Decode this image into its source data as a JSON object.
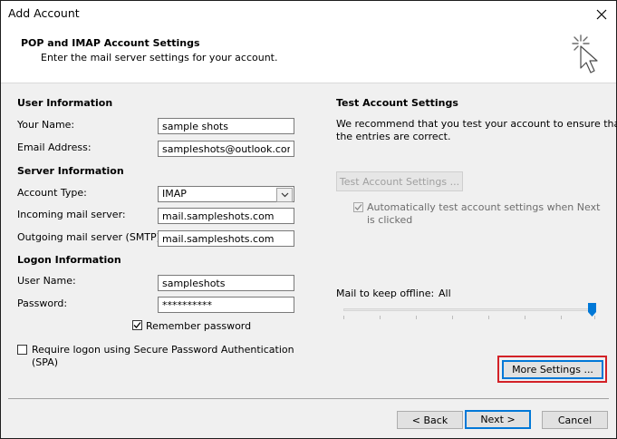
{
  "window": {
    "title": "Add Account"
  },
  "header": {
    "title": "POP and IMAP Account Settings",
    "subtitle": "Enter the mail server settings for your account."
  },
  "user_information": {
    "heading": "User Information",
    "your_name_label": "Your Name:",
    "your_name_value": "sample shots",
    "email_label": "Email Address:",
    "email_value": "sampleshots@outlook.com"
  },
  "server_information": {
    "heading": "Server Information",
    "account_type_label": "Account Type:",
    "account_type_value": "IMAP",
    "incoming_label": "Incoming mail server:",
    "incoming_value": "mail.sampleshots.com",
    "outgoing_label": "Outgoing mail server (SMTP):",
    "outgoing_value": "mail.sampleshots.com"
  },
  "logon_information": {
    "heading": "Logon Information",
    "user_name_label": "User Name:",
    "user_name_value": "sampleshots",
    "password_label": "Password:",
    "password_value": "**********",
    "remember_label": "Remember password",
    "remember_checked": true,
    "spa_label_line1": "Require logon using Secure Password Authentication",
    "spa_label_line2": "(SPA)",
    "spa_checked": false
  },
  "test_settings": {
    "heading": "Test Account Settings",
    "description_line1": "We recommend that you test your account to ensure that",
    "description_line2": "the entries are correct.",
    "test_button": "Test Account Settings ...",
    "auto_test_line1": "Automatically test account settings when Next",
    "auto_test_line2": "is clicked",
    "auto_test_checked": true
  },
  "offline": {
    "label": "Mail to keep offline:",
    "value": "All",
    "slider_fraction": 1.0
  },
  "buttons": {
    "more_settings": "More Settings ...",
    "back": "< Back",
    "next": "Next >",
    "cancel": "Cancel"
  },
  "colors": {
    "highlight_border": "#d32127",
    "default_button_border": "#0078d7",
    "slider_thumb": "#0078d7"
  },
  "icons": [
    "close-icon",
    "wizard-cursor-icon",
    "chevron-down-icon",
    "checkmark-icon"
  ]
}
